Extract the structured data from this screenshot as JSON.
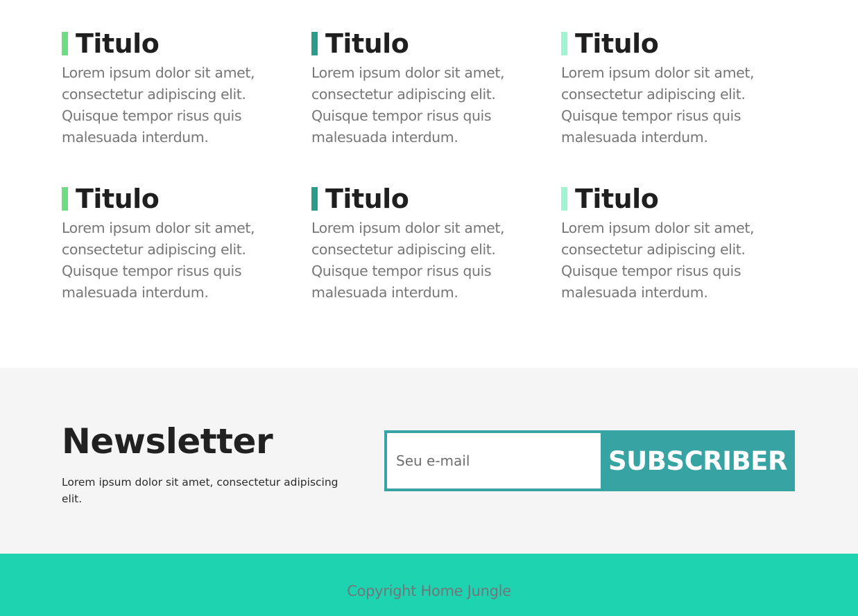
{
  "features": [
    {
      "title": "Titulo",
      "text": "Lorem ipsum dolor sit amet, consectetur adipiscing elit. Quisque tempor risus quis malesuada interdum.",
      "bar_color": "#6ddc85"
    },
    {
      "title": "Titulo",
      "text": "Lorem ipsum dolor sit amet, consectetur adipiscing elit. Quisque tempor risus quis malesuada interdum.",
      "bar_color": "#2a9d8a"
    },
    {
      "title": "Titulo",
      "text": "Lorem ipsum dolor sit amet, consectetur adipiscing elit. Quisque tempor risus quis malesuada interdum.",
      "bar_color": "#9ef5cf"
    },
    {
      "title": "Titulo",
      "text": "Lorem ipsum dolor sit amet, consectetur adipiscing elit. Quisque tempor risus quis malesuada interdum.",
      "bar_color": "#6ddc85"
    },
    {
      "title": "Titulo",
      "text": "Lorem ipsum dolor sit amet, consectetur adipiscing elit. Quisque tempor risus quis malesuada interdum.",
      "bar_color": "#2a9d8a"
    },
    {
      "title": "Titulo",
      "text": "Lorem ipsum dolor sit amet, consectetur adipiscing elit. Quisque tempor risus quis malesuada interdum.",
      "bar_color": "#9ef5cf"
    }
  ],
  "newsletter": {
    "title": "Newsletter",
    "text": "Lorem ipsum dolor sit amet, consectetur adipiscing elit.",
    "email_placeholder": "Seu e-mail",
    "email_value": "",
    "button_label": "SUBSCRIBER",
    "accent_color": "#37a3a3",
    "background_color": "#f5f5f5"
  },
  "footer": {
    "copyright": "Copyright Home Jungle",
    "background_color": "#1dd3b0"
  }
}
